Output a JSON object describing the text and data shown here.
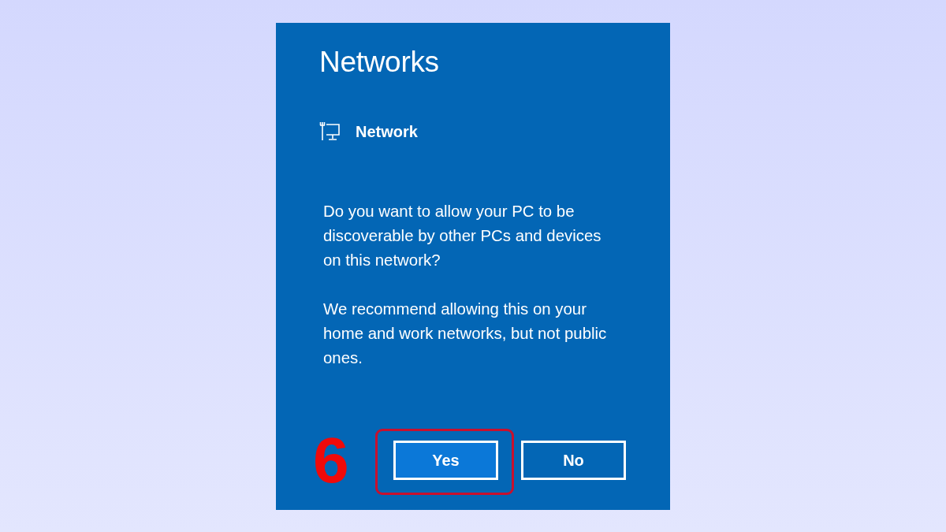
{
  "dialog": {
    "title": "Networks",
    "network": {
      "name": "Network"
    },
    "paragraphs": [
      "Do you want to allow your PC to be discoverable by other PCs and devices on this network?",
      "We recommend allowing this on your home and work networks, but not public ones."
    ],
    "buttons": [
      {
        "label": "Yes",
        "default": true,
        "highlighted": true
      },
      {
        "label": "No",
        "default": false,
        "highlighted": false
      }
    ]
  },
  "annotation": {
    "step": "6"
  }
}
